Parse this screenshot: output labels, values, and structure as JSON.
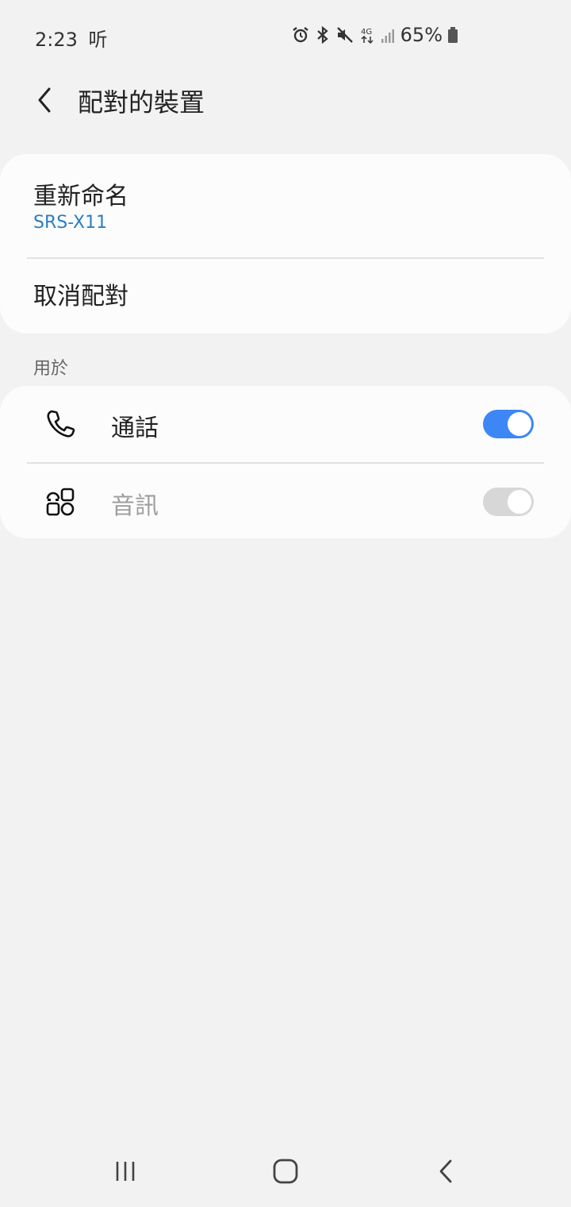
{
  "status_bar": {
    "time": "2:23",
    "notification_icon": "listen-glyph-icon",
    "notification_text": "听",
    "battery_percent": "65%",
    "icons": [
      "alarm-icon",
      "bluetooth-icon",
      "mute-icon",
      "4g-icon",
      "signal-icon",
      "battery-icon"
    ]
  },
  "header": {
    "title": "配對的裝置"
  },
  "device_card": {
    "rename_label": "重新命名",
    "device_name": "SRS-X11",
    "unpair_label": "取消配對"
  },
  "usage_section": {
    "header": "用於",
    "items": [
      {
        "label": "通話",
        "icon": "phone-icon",
        "enabled": true
      },
      {
        "label": "音訊",
        "icon": "audio-apps-icon",
        "enabled": false
      }
    ]
  },
  "colors": {
    "accent": "#3d86f5",
    "link": "#2b7ec2",
    "background": "#f2f2f2",
    "card": "#fcfcfc"
  },
  "nav_bar": {
    "buttons": [
      "recents-icon",
      "home-icon",
      "back-icon"
    ]
  }
}
